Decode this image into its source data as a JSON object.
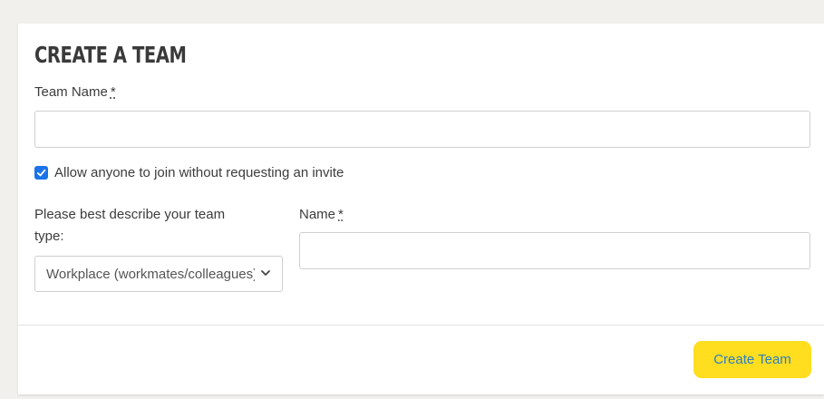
{
  "form": {
    "title": "CREATE A TEAM",
    "team_name_label": "Team Name",
    "required_marker": "*",
    "team_name_value": "",
    "allow_join_checked": true,
    "allow_join_label": "Allow anyone to join without requesting an invite",
    "team_type_label_line1": "Please best describe your team",
    "team_type_label_line2": "type:",
    "team_type_selected": "Workplace (workmates/colleagues)",
    "name_label": "Name",
    "name_value": "",
    "submit_label": "Create Team"
  },
  "colors": {
    "background": "#f1f0ed",
    "card": "#ffffff",
    "button": "#ffdd1f",
    "button_text": "#2b7fc4",
    "checkbox": "#1a73e8"
  },
  "icons": {
    "checkbox": "checkmark-icon",
    "select": "chevron-down-icon"
  }
}
